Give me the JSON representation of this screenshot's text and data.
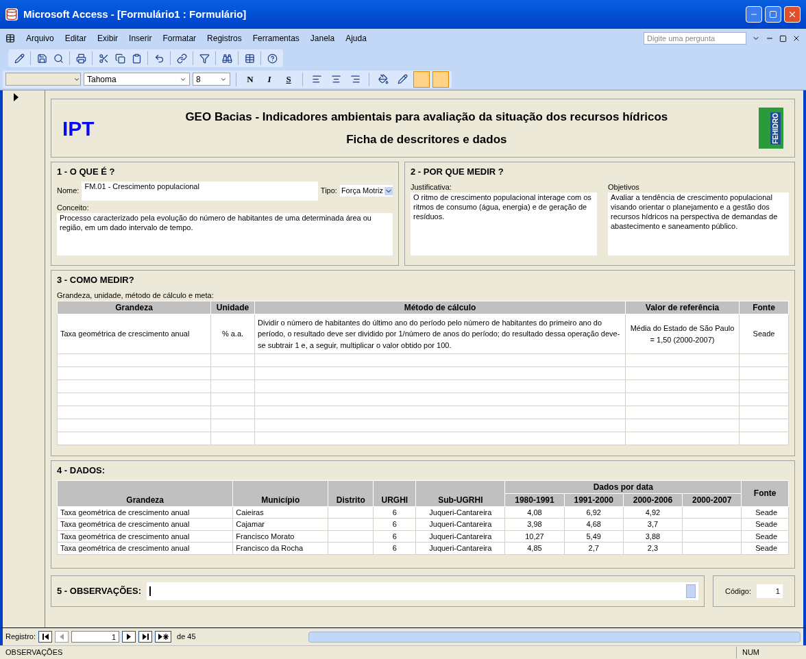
{
  "window": {
    "title": "Microsoft Access - [Formulário1 : Formulário]"
  },
  "menu": [
    "Arquivo",
    "Editar",
    "Exibir",
    "Inserir",
    "Formatar",
    "Registros",
    "Ferramentas",
    "Janela",
    "Ajuda"
  ],
  "help_box": {
    "placeholder": "Digite uma pergunta"
  },
  "format_toolbar": {
    "font": "Tahoma",
    "size": "8",
    "styles": [
      "N",
      "I",
      "S"
    ]
  },
  "header": {
    "logo": "IPT",
    "title": "GEO Bacias  - Indicadores ambientais para avaliação da situação dos recursos hídricos",
    "subtitle": "Ficha de descritores e dados",
    "badge": "FEHIDRO"
  },
  "section1": {
    "title": "1 - O QUE É ?",
    "name_label": "Nome:",
    "name_value": "FM.01 - Crescimento populacional",
    "type_label": "Tipo:",
    "type_value": "Força Motriz",
    "concept_label": "Conceito:",
    "concept_value": "Processo caracterizado pela evolução do número de habitantes de uma determinada área ou região, em um dado intervalo de tempo."
  },
  "section2": {
    "title": "2 - POR QUE MEDIR ?",
    "justification_label": "Justificativa:",
    "justification_value": "O ritmo de crescimento populacional interage com os ritmos de consumo (água, energia) e de geração de resíduos.",
    "objectives_label": "Objetivos",
    "objectives_value": "Avaliar a tendência de crescimento populacional visando orientar o planejamento e a gestão dos recursos hídricos na perspectiva de demandas de abastecimento e saneamento público."
  },
  "section3": {
    "title": "3 - COMO MEDIR?",
    "caption": "Grandeza, unidade, método de cálculo e meta:",
    "table": {
      "columns": [
        "Grandeza",
        "Unidade",
        "Método de cálculo",
        "Valor de referência",
        "Fonte"
      ],
      "rows": [
        [
          "Taxa geométrica de crescimento anual",
          "% a.a.",
          "Dividir o número de habitantes do último ano do período pelo número de habitantes do primeiro ano do período, o resultado deve ser dividido por 1/número de anos do período; do resultado dessa operação deve-se subtrair 1 e, a seguir, multiplicar o valor obtido por 100.",
          "Média do Estado de São Paulo = 1,50 (2000-2007)",
          "Seade"
        ]
      ]
    }
  },
  "section4": {
    "title": "4 - DADOS:",
    "table": {
      "columns": [
        "Grandeza",
        "Município",
        "Distrito",
        "URGHI",
        "Sub-UGRHI"
      ],
      "group": "Dados por data",
      "group_columns": [
        "1980-1991",
        "1991-2000",
        "2000-2006",
        "2000-2007"
      ],
      "last_column": "Fonte",
      "rows": [
        [
          "Taxa geométrica de crescimento anual",
          "Caieiras",
          "",
          "6",
          "Juqueri-Cantareira",
          "4,08",
          "6,92",
          "4,92",
          "",
          "Seade"
        ],
        [
          "Taxa geométrica de crescimento anual",
          "Cajamar",
          "",
          "6",
          "Juqueri-Cantareira",
          "3,98",
          "4,68",
          "3,7",
          "",
          "Seade"
        ],
        [
          "Taxa geométrica de crescimento anual",
          "Francisco Morato",
          "",
          "6",
          "Juqueri-Cantareira",
          "10,27",
          "5,49",
          "3,88",
          "",
          "Seade"
        ],
        [
          "Taxa geométrica de crescimento anual",
          "Francisco da Rocha",
          "",
          "6",
          "Juqueri-Cantareira",
          "4,85",
          "2,7",
          "2,3",
          "",
          "Seade"
        ]
      ]
    }
  },
  "section5": {
    "title": "5 - OBSERVAÇÕES:",
    "code_label": "Código:",
    "code_value": "1"
  },
  "navigation": {
    "label": "Registro:",
    "record": "1",
    "total": "de 45"
  },
  "status_bar": {
    "text": "OBSERVAÇÕES",
    "indicator": "NUM"
  }
}
